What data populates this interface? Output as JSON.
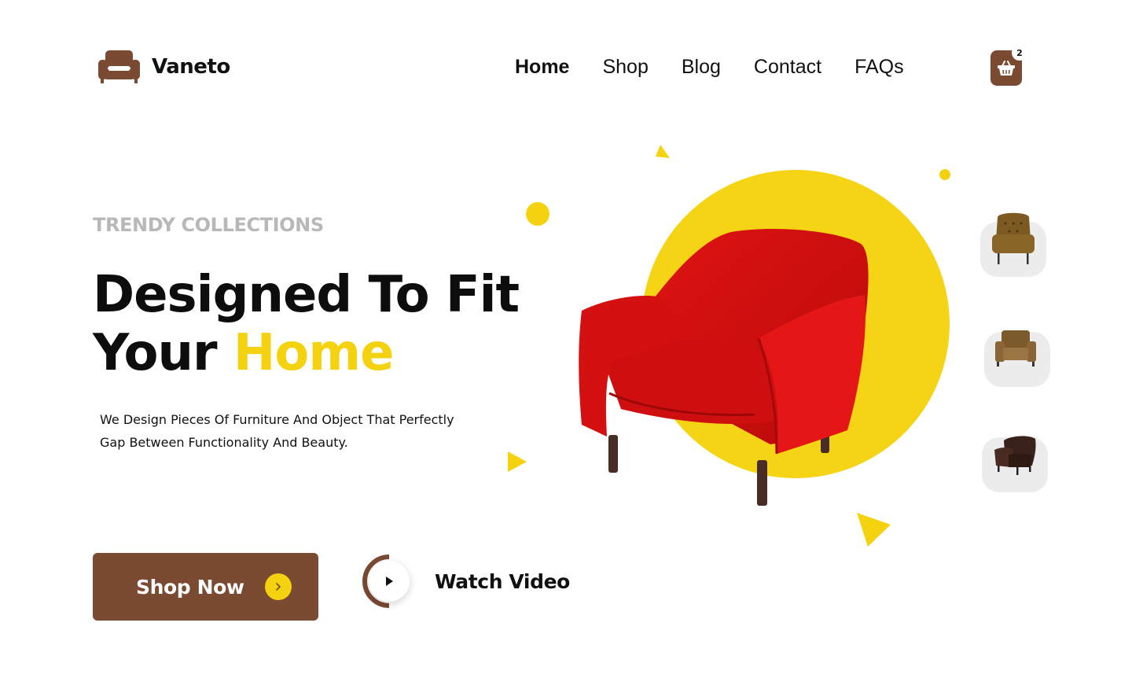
{
  "brand": {
    "name": "Vaneto",
    "logo_icon": "sofa-icon"
  },
  "nav": {
    "items": [
      {
        "label": "Home",
        "active": true
      },
      {
        "label": "Shop",
        "active": false
      },
      {
        "label": "Blog",
        "active": false
      },
      {
        "label": "Contact",
        "active": false
      },
      {
        "label": "FAQs",
        "active": false
      }
    ]
  },
  "cart": {
    "count": "2",
    "icon": "basket-icon"
  },
  "hero": {
    "eyebrow": "TRENDY COLLECTIONS",
    "headline_line1": "Designed To Fit",
    "headline_line2_plain": "Your ",
    "headline_line2_accent": "Home",
    "description": "We Design Pieces Of Furniture And Object That Perfectly Gap Between Functionality And Beauty."
  },
  "cta": {
    "shop_label": "Shop Now",
    "watch_label": "Watch Video"
  },
  "thumbnails": [
    {
      "name": "tufted-wingback-chair",
      "color": "#7d5a22"
    },
    {
      "name": "leather-club-armchair",
      "color": "#8a6535"
    },
    {
      "name": "dark-brown-armchair",
      "color": "#3b211b"
    }
  ],
  "colors": {
    "brown": "#7a4a32",
    "yellow": "#f5d20f",
    "chair_red": "#d20e0e",
    "muted_gray": "#b8b8b8"
  }
}
